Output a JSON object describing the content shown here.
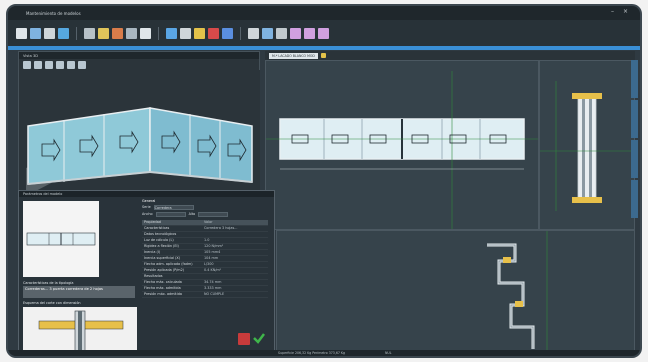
{
  "window": {
    "title": "Mantenimiento de modelos"
  },
  "win3d": {
    "title": "Vista 3D"
  },
  "doc": {
    "tab_label": "M.* LACADO BLANCO MOD"
  },
  "dialog": {
    "title": "Parámetros del modelo",
    "tipology_label": "Características de la tipología",
    "tipology_value": "Correderas... 3 puerta corredera de 2 hojas",
    "section_label": "Esquema del corte con dimensión",
    "general_label": "General",
    "serie_label": "Serie",
    "serie_value": "Corredera",
    "ancho_label": "Ancho",
    "alto_label": "Alto",
    "table_head": [
      "Propiedad",
      "Valor"
    ],
    "rows": [
      [
        "Características",
        "Corredera 3 hojas..."
      ],
      [
        "Datos tecnológicos",
        ""
      ],
      [
        "Luz de cálculo (L)",
        "1.0"
      ],
      [
        "Rigidez a flexión (EI)",
        "120 N/mm²"
      ],
      [
        "Inercia (I)",
        "105 mm4"
      ],
      [
        "Inercia superficial (X)",
        "104 mm"
      ],
      [
        "Flecha adm. aplicada (fadm)",
        "L/300"
      ],
      [
        "Presión aplicada (P/m2)",
        "0.4 KN/m²"
      ],
      [
        "Resultados",
        ""
      ],
      [
        "Flecha máx. calculada",
        "34.74 mm"
      ],
      [
        "Flecha máx. admitida",
        "3.333 mm"
      ],
      [
        "Presión máx. admitida",
        "NO CUMPLE"
      ]
    ]
  },
  "status": {
    "left": "Superficie 206,32 Kg   Perímetro 373,67 Kg",
    "right": "NUL"
  }
}
